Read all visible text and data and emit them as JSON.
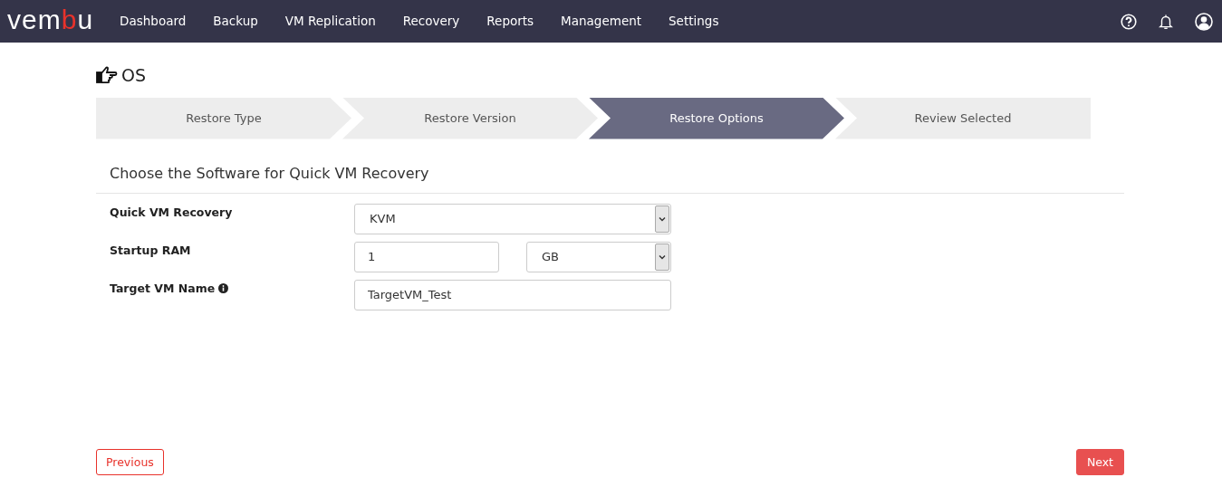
{
  "navbar": {
    "logo": {
      "lead": "vem",
      "accent": "b",
      "tail": "u"
    },
    "menu": [
      {
        "label": "Dashboard"
      },
      {
        "label": "Backup"
      },
      {
        "label": "VM Replication"
      },
      {
        "label": "Recovery"
      },
      {
        "label": "Reports"
      },
      {
        "label": "Management"
      },
      {
        "label": "Settings"
      }
    ],
    "icons": [
      {
        "kind": "help"
      },
      {
        "kind": "bell"
      },
      {
        "kind": "user"
      }
    ]
  },
  "page_title": "OS",
  "steps": [
    {
      "label": "Restore Type",
      "selected": false
    },
    {
      "label": "Restore Version",
      "selected": false
    },
    {
      "label": "Restore Options",
      "selected": true
    },
    {
      "label": "Review Selected",
      "selected": false
    }
  ],
  "section_title": "Choose the Software for Quick VM Recovery",
  "fields": [
    {
      "label": "Quick VM Recovery",
      "kind": "select",
      "value": "KVM"
    },
    {
      "label": "Startup RAM",
      "kind": "amount",
      "value": "1",
      "unit": "GB"
    },
    {
      "label": "Target VM Name",
      "kind": "text",
      "value": "TargetVM_Test",
      "info": true
    }
  ],
  "buttons": {
    "previous": "Previous",
    "next": "Next"
  }
}
